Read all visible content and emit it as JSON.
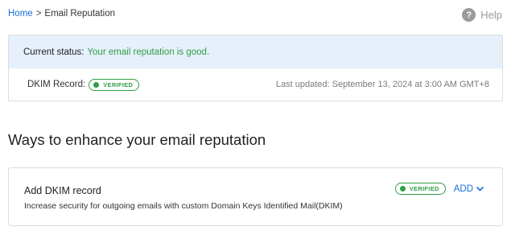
{
  "breadcrumb": {
    "home": "Home",
    "separator": ">",
    "current": "Email Reputation"
  },
  "help": {
    "icon": "help-circle-icon",
    "label": "Help"
  },
  "status": {
    "label": "Current status:",
    "value": "Your email reputation is good.",
    "dkim_label": "DKIM Record:",
    "dkim_badge": "VERIFIED",
    "last_updated": "Last updated: September 13, 2024 at 3:00 AM GMT+8"
  },
  "section": {
    "title": "Ways to enhance your email reputation"
  },
  "methods": [
    {
      "title": "Add DKIM record",
      "description": "Increase security for outgoing emails with custom Domain Keys Identified Mail(DKIM)",
      "badge": "VERIFIED",
      "action": "ADD"
    }
  ],
  "colors": {
    "link": "#1a6fd8",
    "success": "#2f9e44",
    "status_bg": "#e6f0fb"
  }
}
